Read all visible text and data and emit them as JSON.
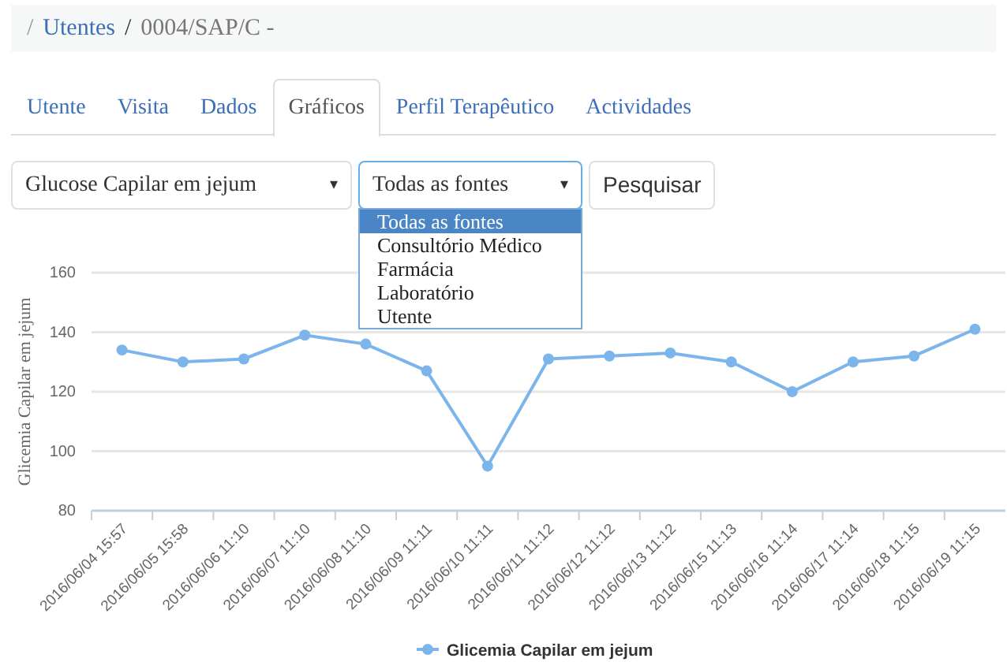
{
  "breadcrumb": {
    "separator": "/",
    "items": [
      {
        "label": "Utentes",
        "link": true
      },
      {
        "label": "0004/SAP/C -",
        "link": false
      }
    ]
  },
  "tabs": [
    {
      "label": "Utente",
      "selected": false
    },
    {
      "label": "Visita",
      "selected": false
    },
    {
      "label": "Dados",
      "selected": false
    },
    {
      "label": "Gráficos",
      "selected": true
    },
    {
      "label": "Perfil Terapêutico",
      "selected": false
    },
    {
      "label": "Actividades",
      "selected": false
    }
  ],
  "filters": [
    {
      "value": "Glucose Capilar em jejum",
      "expanded": false,
      "caret": "▾"
    },
    {
      "value": "Todas as fontes",
      "expanded": true,
      "caret": "▾",
      "options": [
        {
          "label": "Todas as fontes",
          "selected": true
        },
        {
          "label": "Consultório Médico",
          "selected": false
        },
        {
          "label": "Farmácia",
          "selected": false
        },
        {
          "label": "Laboratório",
          "selected": false
        },
        {
          "label": "Utente",
          "selected": false
        }
      ]
    }
  ],
  "search_button": "Pesquisar",
  "chart": {
    "chart_data": {
      "type": "line",
      "ylabel": "Glicemia Capilar em jejum",
      "grid": true,
      "categories": [
        "2016/06/04 15:57",
        "2016/06/05 15:58",
        "2016/06/06 11:10",
        "2016/06/07 11:10",
        "2016/06/08 11:10",
        "2016/06/09 11:11",
        "2016/06/10 11:11",
        "2016/06/11 11:12",
        "2016/06/12 11:12",
        "2016/06/13 11:12",
        "2016/06/15 11:13",
        "2016/06/16 11:14",
        "2016/06/17 11:14",
        "2016/06/18 11:15",
        "2016/06/19 11:15"
      ],
      "ylim": [
        80,
        160
      ],
      "yticks": [
        80,
        100,
        120,
        140,
        160
      ],
      "series": [
        {
          "name": "Glicemia Capilar em jejum",
          "color": "#7cb5ec",
          "marker": true,
          "values": [
            134,
            130,
            131,
            139,
            136,
            127,
            95,
            131,
            132,
            133,
            130,
            120,
            130,
            132,
            141
          ]
        }
      ]
    }
  }
}
